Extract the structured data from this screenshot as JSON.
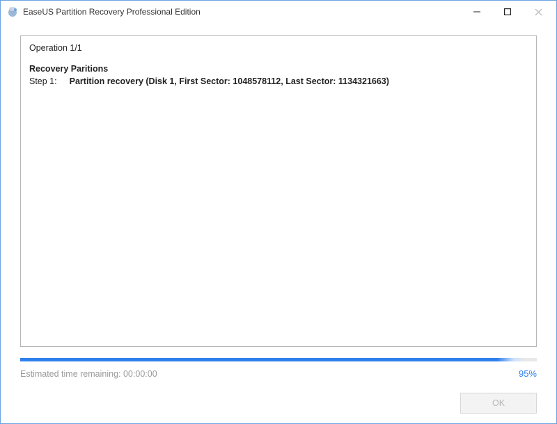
{
  "window": {
    "title": "EaseUS Partition Recovery Professional Edition"
  },
  "log": {
    "operation_line": "Operation 1/1",
    "heading": "Recovery Paritions",
    "step_label": "Step 1:",
    "step_detail": "Partition recovery (Disk 1, First Sector: 1048578112, Last Sector: 1134321663)"
  },
  "progress": {
    "percent": 95,
    "percent_label": "95%",
    "eta_prefix": "Estimated time remaining: ",
    "eta_value": "00:00:00"
  },
  "buttons": {
    "ok_label": "OK",
    "ok_enabled": false
  }
}
